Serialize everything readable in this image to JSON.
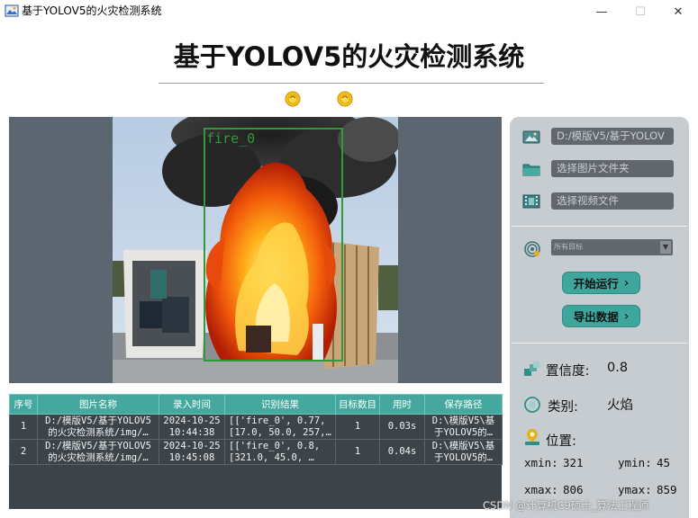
{
  "window": {
    "title": "基于YOLOV5的火灾检测系统",
    "min_glyph": "—",
    "max_glyph": "☐",
    "close_glyph": "✕"
  },
  "header": {
    "title": "基于YOLOV5的火灾检测系统"
  },
  "detection": {
    "box_label": "fire_0"
  },
  "table": {
    "columns": [
      "序号",
      "图片名称",
      "录入时间",
      "识别结果",
      "目标数目",
      "用时",
      "保存路径"
    ],
    "rows": [
      {
        "index": "1",
        "name_line1": "D:/模版V5/基于YOLOV5",
        "name_line2": "的火灾检测系统/img/…",
        "time_line1": "2024-10-25",
        "time_line2": "10:44:38",
        "result_line1": "[['fire_0', 0.77,",
        "result_line2": "[17.0, 50.0, 257,…",
        "count": "1",
        "duration": "0.03s",
        "path_line1": "D:\\模版V5\\基",
        "path_line2": "于YOLOV5的…"
      },
      {
        "index": "2",
        "name_line1": "D:/模版V5/基于YOLOV5",
        "name_line2": "的火灾检测系统/img/…",
        "time_line1": "2024-10-25",
        "time_line2": "10:45:08",
        "result_line1": "[['fire_0', 0.8,",
        "result_line2": "[321.0, 45.0, …",
        "count": "1",
        "duration": "0.04s",
        "path_line1": "D:\\模版V5\\基",
        "path_line2": "于YOLOV5的…"
      }
    ]
  },
  "sidebar": {
    "image_path_value": "D:/模版V5/基于YOLOV",
    "folder_placeholder": "选择图片文件夹",
    "video_placeholder": "选择视频文件",
    "target_select_value": "所有目标",
    "run_button": "开始运行",
    "export_button": "导出数据",
    "chevron": "›",
    "confidence_label": "置信度:",
    "confidence_value": "0.8",
    "class_label": "类别:",
    "class_value": "火焰",
    "position_label": "位置:",
    "xmin_label": "xmin:",
    "xmin_value": "321",
    "ymin_label": "ymin:",
    "ymin_value": "45",
    "xmax_label": "xmax:",
    "xmax_value": "806",
    "ymax_label": "ymax:",
    "ymax_value": "859"
  },
  "watermark": "CSDN @计算机C9硕士_算法工程师",
  "colors": {
    "accent": "#3ea69c",
    "table_header": "#44a89f",
    "image_panel_bg": "#5b6670",
    "sidebar_bg": "#c7ccd1",
    "detection_box": "#2e9a3a"
  }
}
